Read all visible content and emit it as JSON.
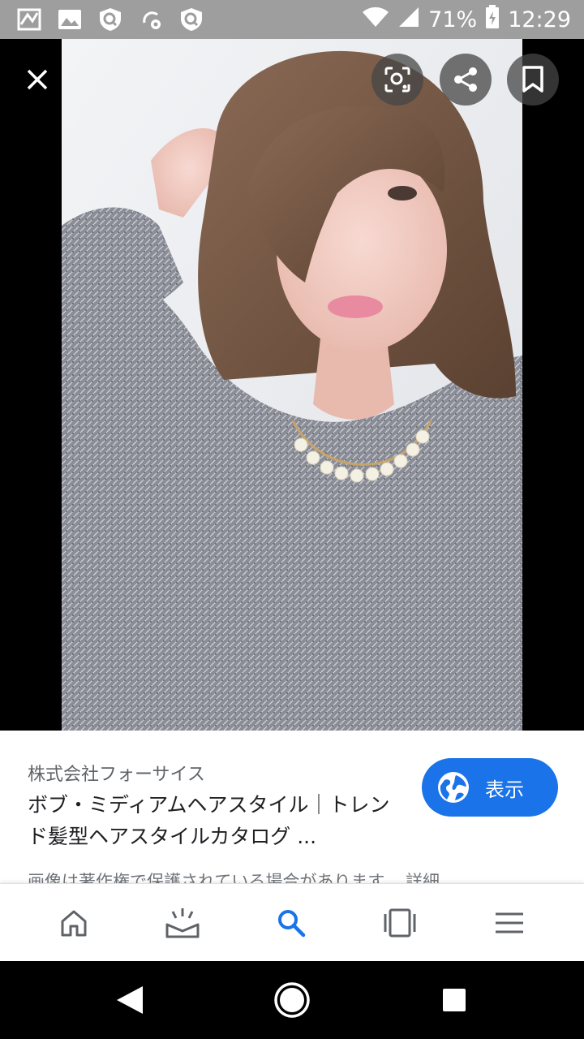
{
  "status_bar": {
    "battery": "71%",
    "time": "12:29",
    "icons": [
      "app-notification-icon",
      "image-icon",
      "shield-icon",
      "settings-sync-icon",
      "shield-icon",
      "wifi-icon",
      "signal-icon",
      "battery-icon"
    ]
  },
  "viewer": {
    "icons": [
      "close-icon",
      "lens-icon",
      "share-icon",
      "bookmark-icon"
    ]
  },
  "result": {
    "source": "株式会社フォーサイス",
    "title": "ボブ・ミディアムヘアスタイル｜トレンド髪型ヘアスタイルカタログ ...",
    "visit_label": "表示",
    "copyright_note": "画像は著作権で保護されている場合があります。 詳細"
  },
  "bottom_nav": {
    "items": [
      "home-icon",
      "updates-icon",
      "search-icon",
      "tabs-icon",
      "menu-icon"
    ],
    "active": "search-icon"
  },
  "colors": {
    "accent": "#1a73e8",
    "status_bar": "#9e9e9e"
  }
}
